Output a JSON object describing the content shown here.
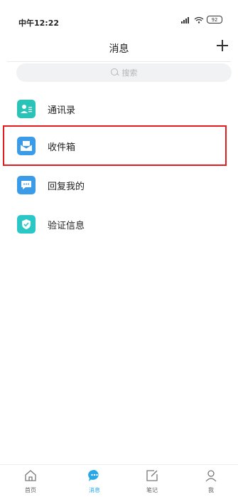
{
  "status_bar": {
    "time": "中午12:22",
    "battery": "92"
  },
  "header": {
    "title": "消息"
  },
  "search": {
    "placeholder": "搜索"
  },
  "list": [
    {
      "label": "通讯录",
      "icon": "contacts-icon",
      "color": "#29c3b8"
    },
    {
      "label": "收件箱",
      "icon": "inbox-icon",
      "color": "#3a9be8"
    },
    {
      "label": "回复我的",
      "icon": "reply-icon",
      "color": "#3a9be8"
    },
    {
      "label": "验证信息",
      "icon": "verify-shield-icon",
      "color": "#2bc7c7"
    }
  ],
  "bottom_nav": [
    {
      "label": "首页",
      "icon": "home-icon",
      "active": false
    },
    {
      "label": "消息",
      "icon": "message-icon",
      "active": true
    },
    {
      "label": "笔记",
      "icon": "note-icon",
      "active": false
    },
    {
      "label": "我",
      "icon": "profile-icon",
      "active": false
    }
  ],
  "colors": {
    "accent": "#2aa8e6",
    "highlight": "#e61b1b"
  }
}
